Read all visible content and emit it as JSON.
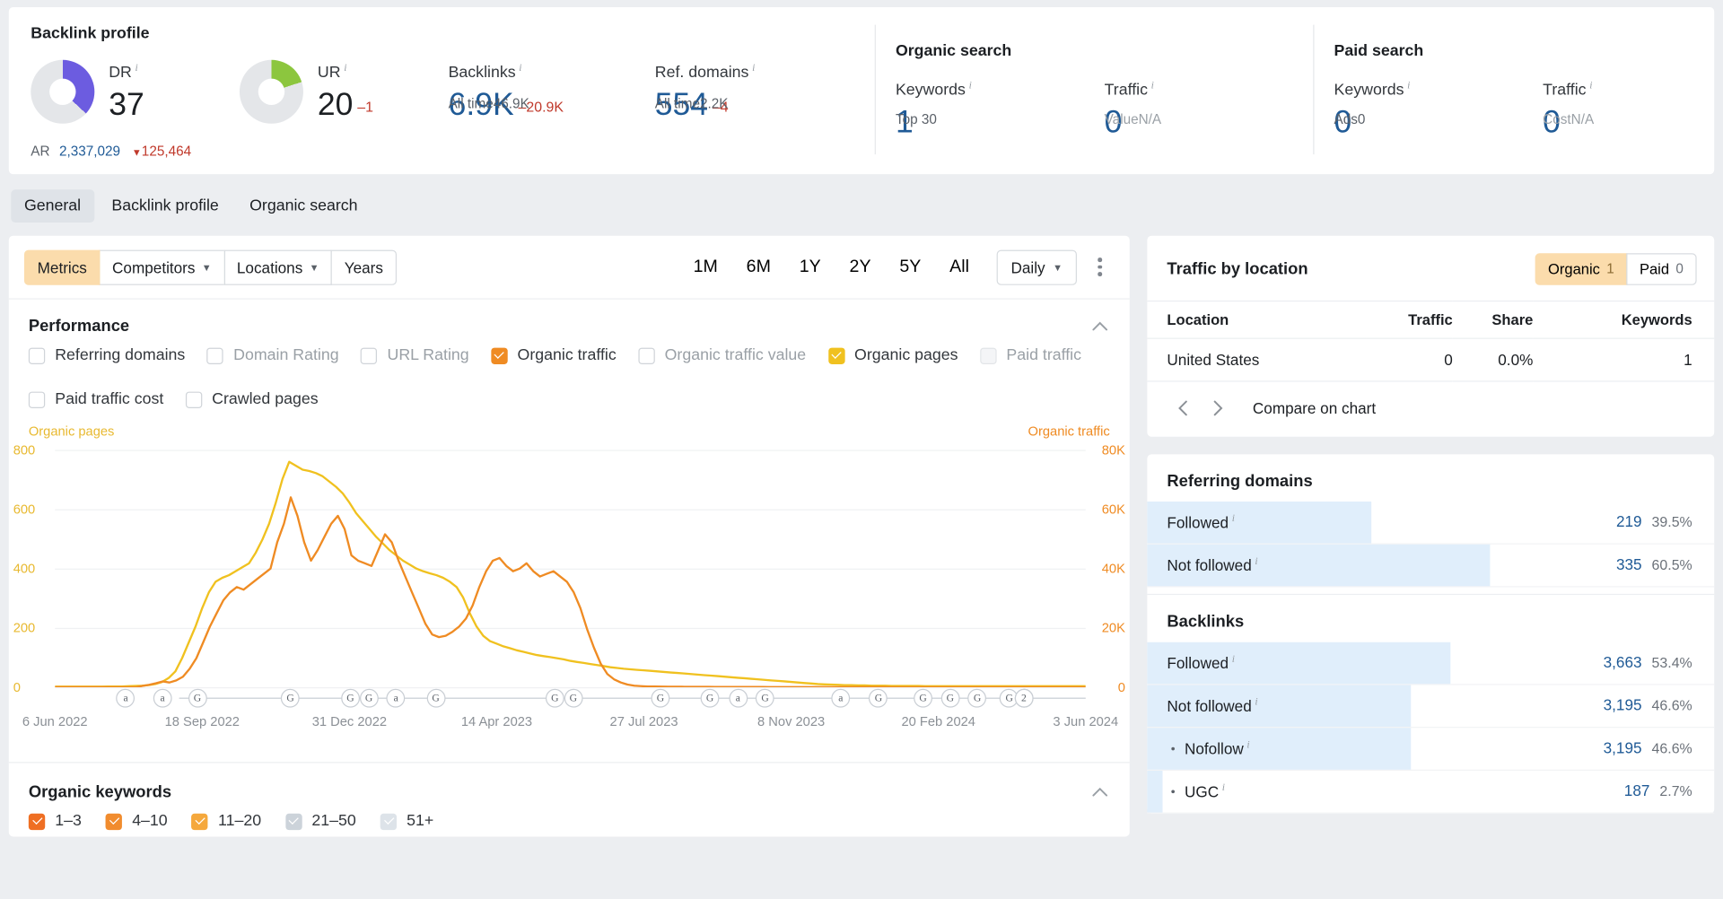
{
  "overview": {
    "backlink_profile": {
      "title": "Backlink profile",
      "dr": {
        "label": "DR",
        "value": "37",
        "ring_pct": 37,
        "color": "#6c5ce0"
      },
      "ur": {
        "label": "UR",
        "value": "20",
        "delta": "–1",
        "ring_pct": 20,
        "color": "#8cc63e"
      },
      "backlinks": {
        "label": "Backlinks",
        "value": "6.9K",
        "delta": "–20.9K",
        "sub_label": "All time",
        "sub_value": "46.9K"
      },
      "ref_domains": {
        "label": "Ref. domains",
        "value": "554",
        "delta": "–4",
        "sub_label": "All time",
        "sub_value": "2.2K"
      },
      "ar": {
        "label": "AR",
        "value": "2,337,029",
        "delta": "125,464",
        "delta_caret": "▼"
      }
    },
    "organic_search": {
      "title": "Organic search",
      "keywords": {
        "label": "Keywords",
        "value": "1",
        "sub_label": "Top 3",
        "sub_value": "0"
      },
      "traffic": {
        "label": "Traffic",
        "value": "0",
        "sub_label": "Value",
        "sub_value": "N/A"
      }
    },
    "paid_search": {
      "title": "Paid search",
      "keywords": {
        "label": "Keywords",
        "value": "0",
        "sub_label": "Ads",
        "sub_value": "0"
      },
      "traffic": {
        "label": "Traffic",
        "value": "0",
        "sub_label": "Cost",
        "sub_value": "N/A"
      }
    }
  },
  "tabs": [
    {
      "label": "General",
      "active": true
    },
    {
      "label": "Backlink profile",
      "active": false
    },
    {
      "label": "Organic search",
      "active": false
    }
  ],
  "toolbar": {
    "metrics_label": "Metrics",
    "competitors_label": "Competitors",
    "locations_label": "Locations",
    "years_label": "Years",
    "ranges": [
      "1M",
      "6M",
      "1Y",
      "2Y",
      "5Y",
      "All"
    ],
    "range_selected": "2Y",
    "granularity": "Daily",
    "kebab_label": "more-options"
  },
  "performance": {
    "title": "Performance",
    "checkboxes": [
      {
        "label": "Referring domains",
        "checked": false,
        "disabled": false,
        "color": ""
      },
      {
        "label": "Domain Rating",
        "checked": false,
        "disabled": false,
        "color": ""
      },
      {
        "label": "URL Rating",
        "checked": false,
        "disabled": false,
        "color": ""
      },
      {
        "label": "Organic traffic",
        "checked": true,
        "disabled": false,
        "color": "#ef8b23"
      },
      {
        "label": "Organic traffic value",
        "checked": false,
        "disabled": false,
        "color": ""
      },
      {
        "label": "Organic pages",
        "checked": true,
        "disabled": false,
        "color": "#f0c11f"
      },
      {
        "label": "Paid traffic",
        "checked": false,
        "disabled": true,
        "color": ""
      },
      {
        "label": "Paid traffic cost",
        "checked": false,
        "disabled": false,
        "color": ""
      },
      {
        "label": "Crawled pages",
        "checked": false,
        "disabled": false,
        "color": ""
      }
    ]
  },
  "chart_data": {
    "type": "line",
    "title": "Performance",
    "left_axis_name": "Organic pages",
    "right_axis_name": "Organic traffic",
    "left_axis_color": "#e8b930",
    "right_axis_color": "#ef8b23",
    "left_ticks": [
      "0",
      "200",
      "400",
      "600",
      "800"
    ],
    "right_ticks": [
      "0",
      "20K",
      "40K",
      "60K",
      "80K"
    ],
    "left_ylim": [
      0,
      900
    ],
    "right_ylim": [
      0,
      90000
    ],
    "grid": true,
    "xlabel": "",
    "x_tick_labels": [
      "6 Jun 2022",
      "18 Sep 2022",
      "31 Dec 2022",
      "14 Apr 2023",
      "27 Jul 2023",
      "8 Nov 2023",
      "20 Feb 2024",
      "3 Jun 2024"
    ],
    "series": [
      {
        "name": "Organic pages",
        "color": "#f0c11f",
        "axis": "left",
        "values": [
          2,
          2,
          2,
          2,
          2,
          2,
          2,
          2,
          3,
          3,
          3,
          4,
          5,
          6,
          8,
          12,
          20,
          35,
          60,
          110,
          170,
          230,
          300,
          360,
          400,
          415,
          425,
          440,
          455,
          470,
          510,
          560,
          620,
          700,
          790,
          855,
          840,
          825,
          820,
          812,
          800,
          780,
          760,
          735,
          700,
          660,
          630,
          600,
          570,
          545,
          520,
          500,
          480,
          465,
          450,
          440,
          432,
          425,
          415,
          400,
          380,
          340,
          280,
          230,
          195,
          175,
          165,
          155,
          148,
          140,
          134,
          128,
          122,
          118,
          114,
          110,
          106,
          100,
          96,
          92,
          88,
          84,
          80,
          76,
          73,
          70,
          68,
          66,
          64,
          62,
          60,
          58,
          56,
          54,
          52,
          50,
          48,
          46,
          44,
          42,
          40,
          38,
          36,
          34,
          32,
          30,
          28,
          26,
          24,
          22,
          20,
          18,
          16,
          14,
          12,
          11,
          10,
          9,
          8,
          8,
          7,
          7,
          6,
          6,
          6,
          5,
          5,
          5,
          5,
          5,
          4,
          4,
          4,
          4,
          4,
          4,
          4,
          4,
          4,
          4,
          4,
          4,
          4,
          4,
          4,
          4,
          4,
          4,
          4,
          4,
          4,
          4,
          4,
          4,
          4
        ]
      },
      {
        "name": "Organic traffic",
        "color": "#ef8b23",
        "axis": "right",
        "values": [
          0,
          0,
          0,
          0,
          0,
          0,
          0,
          0,
          0,
          0,
          0,
          0,
          0,
          500,
          900,
          1500,
          2200,
          1800,
          2600,
          4000,
          7000,
          11000,
          17000,
          23000,
          28000,
          33000,
          36000,
          38000,
          37000,
          39000,
          41000,
          43000,
          45000,
          55000,
          62000,
          72000,
          65000,
          55000,
          48000,
          52000,
          57000,
          62000,
          65000,
          60000,
          50000,
          48000,
          47000,
          46000,
          52000,
          58000,
          55000,
          48000,
          42000,
          36000,
          30000,
          24000,
          20000,
          19000,
          19500,
          21000,
          23000,
          26000,
          31000,
          38000,
          44000,
          48000,
          49000,
          46000,
          44000,
          45000,
          47000,
          44000,
          42000,
          43000,
          44000,
          42000,
          40000,
          36000,
          30000,
          22000,
          15000,
          9000,
          5000,
          3000,
          1800,
          1000,
          600,
          400,
          300,
          250,
          200,
          180,
          160,
          150,
          140,
          130,
          120,
          110,
          100,
          95,
          90,
          85,
          80,
          75,
          70,
          65,
          60,
          58,
          55,
          52,
          50,
          48,
          45,
          42,
          40,
          38,
          36,
          34,
          32,
          30,
          28,
          26,
          24,
          22,
          20,
          18,
          16,
          14,
          12,
          10,
          9,
          8,
          7,
          6,
          5,
          5,
          4,
          4,
          4,
          3,
          3,
          3,
          3,
          3,
          3,
          3,
          3,
          3,
          3,
          3,
          3,
          3,
          3,
          3
        ]
      }
    ],
    "event_markers": [
      {
        "x_pct": 7.3,
        "glyph": "a"
      },
      {
        "x_pct": 11.1,
        "glyph": "a"
      },
      {
        "x_pct": 14.7,
        "glyph": "G"
      },
      {
        "x_pct": 24.3,
        "glyph": "G"
      },
      {
        "x_pct": 30.5,
        "glyph": "G"
      },
      {
        "x_pct": 32.4,
        "glyph": "G"
      },
      {
        "x_pct": 35.2,
        "glyph": "a"
      },
      {
        "x_pct": 39.3,
        "glyph": "G"
      },
      {
        "x_pct": 51.6,
        "glyph": "G"
      },
      {
        "x_pct": 53.5,
        "glyph": "G"
      },
      {
        "x_pct": 62.5,
        "glyph": "G"
      },
      {
        "x_pct": 67.6,
        "glyph": "G"
      },
      {
        "x_pct": 70.5,
        "glyph": "a"
      },
      {
        "x_pct": 73.3,
        "glyph": "G"
      },
      {
        "x_pct": 81.1,
        "glyph": "a"
      },
      {
        "x_pct": 85.0,
        "glyph": "G"
      },
      {
        "x_pct": 89.6,
        "glyph": "G"
      },
      {
        "x_pct": 92.4,
        "glyph": "G"
      },
      {
        "x_pct": 95.2,
        "glyph": "G"
      },
      {
        "x_pct": 98.5,
        "glyph": "G"
      },
      {
        "x_pct": 100.0,
        "glyph": "G"
      },
      {
        "x_pct": 104.0,
        "glyph": "a"
      },
      {
        "x_pct": 107.0,
        "glyph": "2"
      }
    ]
  },
  "organic_keywords": {
    "title": "Organic keywords",
    "buckets": [
      {
        "label": "1–3",
        "checked": true,
        "color": "#ef6f23",
        "disabled": false
      },
      {
        "label": "4–10",
        "checked": true,
        "color": "#f18c2e",
        "disabled": false
      },
      {
        "label": "11–20",
        "checked": true,
        "color": "#f5a83c",
        "disabled": false
      },
      {
        "label": "21–50",
        "checked": true,
        "color": "#ccd3da",
        "disabled": true
      },
      {
        "label": "51+",
        "checked": true,
        "color": "#dde3e9",
        "disabled": true
      }
    ]
  },
  "traffic_by_location": {
    "title": "Traffic by location",
    "toggles": [
      {
        "label": "Organic",
        "count": "1",
        "selected": true
      },
      {
        "label": "Paid",
        "count": "0",
        "selected": false
      }
    ],
    "columns": [
      "Location",
      "Traffic",
      "Share",
      "Keywords"
    ],
    "rows": [
      {
        "location": "United States",
        "traffic": "0",
        "share": "0.0%",
        "keywords": "1"
      }
    ],
    "prev_label": "‹",
    "next_label": "›",
    "compare_label": "Compare on chart"
  },
  "referring_domains": {
    "title": "Referring domains",
    "rows": [
      {
        "name": "Followed",
        "value": "219",
        "pct": "39.5%",
        "bar_pct": 39.5,
        "indent": false
      },
      {
        "name": "Not followed",
        "value": "335",
        "pct": "60.5%",
        "bar_pct": 60.5,
        "indent": false
      }
    ]
  },
  "backlinks_panel": {
    "title": "Backlinks",
    "rows": [
      {
        "name": "Followed",
        "value": "3,663",
        "pct": "53.4%",
        "bar_pct": 53.4,
        "indent": false
      },
      {
        "name": "Not followed",
        "value": "3,195",
        "pct": "46.6%",
        "bar_pct": 46.6,
        "indent": false
      },
      {
        "name": "Nofollow",
        "value": "3,195",
        "pct": "46.6%",
        "bar_pct": 46.6,
        "indent": true
      },
      {
        "name": "UGC",
        "value": "187",
        "pct": "2.7%",
        "bar_pct": 2.7,
        "indent": true
      }
    ]
  },
  "colors": {
    "accent_orange": "#ef8b23",
    "accent_yellow": "#f0c11f",
    "link_blue": "#1f5a96",
    "selected_bg": "#fbdcac",
    "bar_blue": "#e0eefb",
    "negative_red": "#c0392b"
  }
}
